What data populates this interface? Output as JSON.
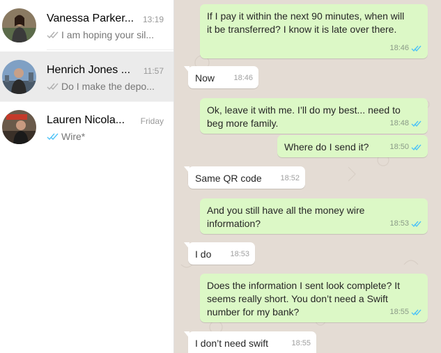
{
  "colors": {
    "outgoing_bubble": "#dcf8c6",
    "incoming_bubble": "#ffffff",
    "read_tick": "#4fc3f7",
    "sent_tick": "#b0b0b0",
    "chat_background": "#e4dcd4"
  },
  "sidebar": {
    "chats": [
      {
        "name": "Vanessa Parker...",
        "time": "13:19",
        "preview": "I am hoping your sil...",
        "tick": "double-gray-tick-icon"
      },
      {
        "name": "Henrich Jones ...",
        "time": "11:57",
        "preview": "Do I make the depo...",
        "tick": "double-gray-tick-icon"
      },
      {
        "name": "Lauren Nicola...",
        "time": "Friday",
        "preview": "Wire*",
        "tick": "double-blue-tick-icon"
      }
    ]
  },
  "messages": [
    {
      "dir": "out",
      "lines": [
        "If I pay it within the next 90 minutes, when will",
        "it be transferred? I know it is late over there."
      ],
      "time": "18:46",
      "tick": "double-blue-tick-icon"
    },
    {
      "dir": "in",
      "lines": [
        "Now"
      ],
      "time": "18:46"
    },
    {
      "dir": "out",
      "lines": [
        "Ok, leave it with me. I’ll do my best... need to",
        "beg more family."
      ],
      "time": "18:48",
      "tick": "double-blue-tick-icon"
    },
    {
      "dir": "out",
      "lines": [
        "Where do I send it?"
      ],
      "time": "18:50",
      "tick": "double-blue-tick-icon"
    },
    {
      "dir": "in",
      "lines": [
        "Same QR code"
      ],
      "time": "18:52"
    },
    {
      "dir": "out",
      "lines": [
        "And you still have all the money wire",
        "information?"
      ],
      "time": "18:53",
      "tick": "double-blue-tick-icon"
    },
    {
      "dir": "in",
      "lines": [
        "I do"
      ],
      "time": "18:53"
    },
    {
      "dir": "out",
      "lines": [
        "Does the information I sent look complete? It",
        "seems really short. You don’t need a Swift",
        "number for my bank?"
      ],
      "time": "18:55",
      "tick": "double-blue-tick-icon"
    },
    {
      "dir": "in",
      "lines": [
        "I don’t need swift"
      ],
      "time": "18:55"
    }
  ]
}
